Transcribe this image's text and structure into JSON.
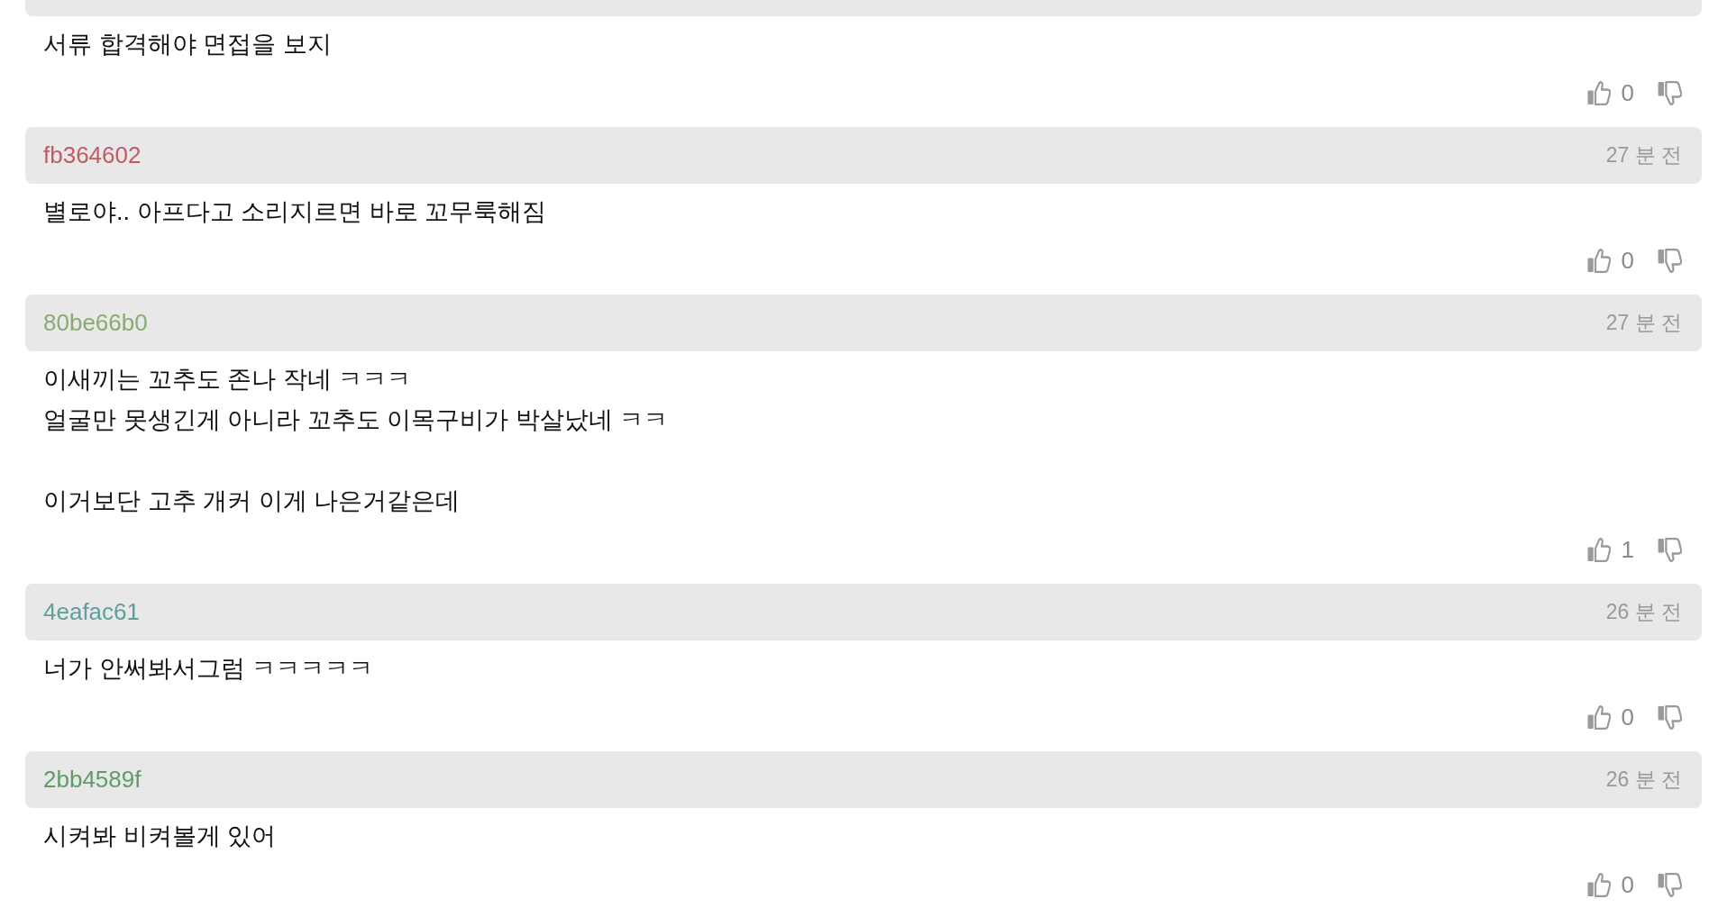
{
  "comments": [
    {
      "text": "서류 합격해야 면접을 보지",
      "likes": "0"
    },
    {
      "user": "fb364602",
      "color": "#c25b63",
      "time": "27 분 전",
      "text": "별로야.. 아프다고 소리지르면 바로 꼬무룩해짐",
      "likes": "0"
    },
    {
      "user": "80be66b0",
      "color": "#88ab72",
      "time": "27 분 전",
      "text": "이새끼는 꼬추도 존나 작네 ㅋㅋㅋ\n얼굴만 못생긴게 아니라 꼬추도 이목구비가 박살났네 ㅋㅋ\n\n이거보단 고추 개커 이게 나은거같은데",
      "likes": "1"
    },
    {
      "user": "4eafac61",
      "color": "#5f9e9a",
      "time": "26 분 전",
      "text": "너가 안써봐서그럼 ㅋㅋㅋㅋㅋ",
      "likes": "0"
    },
    {
      "user": "2bb4589f",
      "color": "#5e9b68",
      "time": "26 분 전",
      "text": "시켜봐 비켜볼게 있어",
      "likes": "0"
    }
  ]
}
